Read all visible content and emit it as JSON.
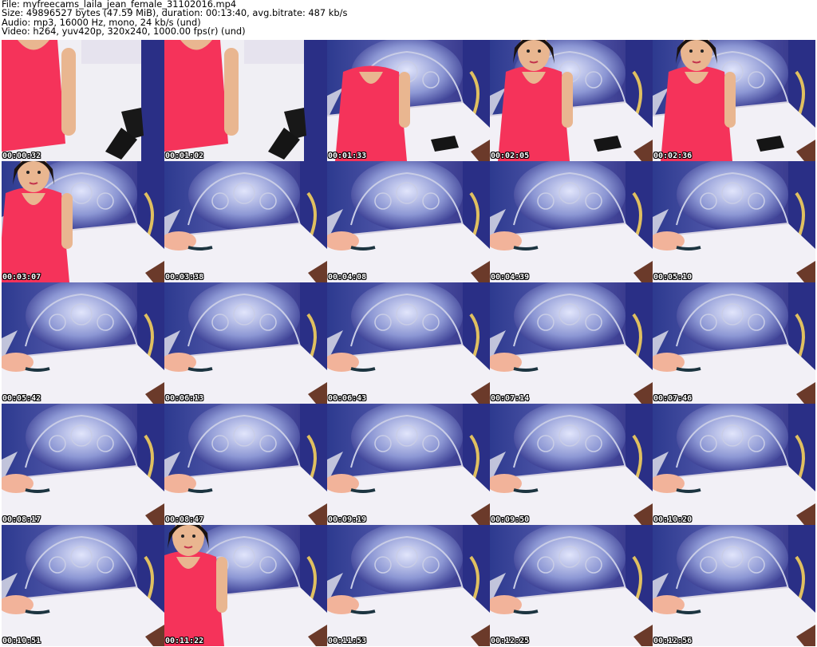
{
  "header": {
    "file_line": "File: myfreecams_laila_jean_female_31102016.mp4",
    "size_line": "Size: 49896527 bytes (47.59 MiB), duration: 00:13:40, avg.bitrate: 487 kb/s",
    "audio_line": "Audio: mp3, 16000 Hz, mono, 24 kb/s (und)",
    "video_line": "Video: h264, yuv420p, 320x240, 1000.00 fps(r) (und)"
  },
  "thumbnails": [
    {
      "time": "00:00:32",
      "scene": "closeup-white"
    },
    {
      "time": "00:01:02",
      "scene": "closeup-white"
    },
    {
      "time": "00:01:33",
      "scene": "person-room"
    },
    {
      "time": "00:02:05",
      "scene": "person-room-face"
    },
    {
      "time": "00:02:36",
      "scene": "person-room-face"
    },
    {
      "time": "00:03:07",
      "scene": "person-left"
    },
    {
      "time": "00:03:38",
      "scene": "empty-room"
    },
    {
      "time": "00:04:08",
      "scene": "empty-room"
    },
    {
      "time": "00:04:39",
      "scene": "empty-room"
    },
    {
      "time": "00:05:10",
      "scene": "empty-room"
    },
    {
      "time": "00:05:42",
      "scene": "empty-room"
    },
    {
      "time": "00:06:13",
      "scene": "empty-room"
    },
    {
      "time": "00:06:43",
      "scene": "empty-room"
    },
    {
      "time": "00:07:14",
      "scene": "empty-room"
    },
    {
      "time": "00:07:46",
      "scene": "empty-room"
    },
    {
      "time": "00:08:17",
      "scene": "empty-room"
    },
    {
      "time": "00:08:47",
      "scene": "empty-room"
    },
    {
      "time": "00:09:19",
      "scene": "empty-room"
    },
    {
      "time": "00:09:50",
      "scene": "empty-room"
    },
    {
      "time": "00:10:20",
      "scene": "empty-room"
    },
    {
      "time": "00:10:51",
      "scene": "empty-room"
    },
    {
      "time": "00:11:22",
      "scene": "person-center"
    },
    {
      "time": "00:11:53",
      "scene": "empty-room"
    },
    {
      "time": "00:12:25",
      "scene": "empty-room"
    },
    {
      "time": "00:12:56",
      "scene": "empty-room"
    }
  ],
  "colors": {
    "wall_blue": "#2a2f86",
    "wall_purple": "#4b3a9a",
    "headboard_silver": "#c9cde6",
    "bed_sheet": "#f2f0f6",
    "dress_pink": "#f5335a",
    "skin": "#e9b690",
    "hair": "#1a1210",
    "pillow_peach": "#f2b39a"
  }
}
